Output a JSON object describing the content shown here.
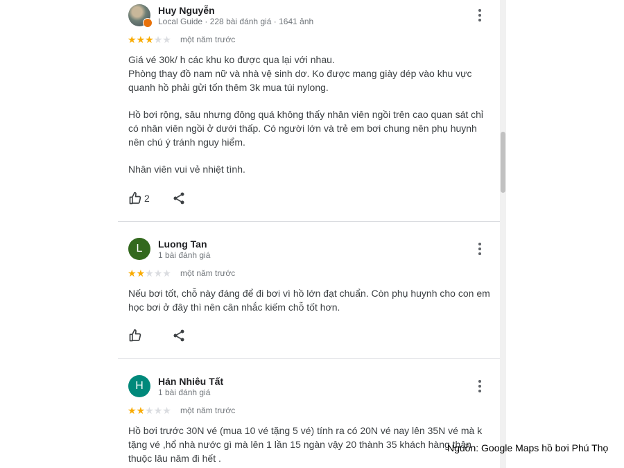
{
  "reviews": [
    {
      "avatar_letter": "",
      "name": "Huy Nguyễn",
      "meta": "Local Guide · 228 bài đánh giá · 1641 ảnh",
      "rating": 3,
      "time": "một năm trước",
      "paragraphs": [
        [
          "Giá vé 30k/ h các khu ko được qua lại với nhau.",
          "Phòng thay đồ nam nữ và nhà vệ sinh dơ. Ko được mang giày dép vào khu vực",
          "quanh hồ phải gửi tốn thêm 3k mua túi nylong."
        ],
        [
          "Hồ bơi rộng, sâu nhưng đông quá không thấy nhân viên ngồi trên cao quan sát chỉ",
          "có nhân viên ngồi ở dưới thấp. Có người lớn và trẻ em bơi chung nên phụ huynh",
          "nên chú ý tránh nguy hiểm."
        ],
        [
          "Nhân viên vui vẻ nhiệt tình."
        ]
      ],
      "likes": "2"
    },
    {
      "avatar_letter": "L",
      "avatar_color": "#33691e",
      "name": "Luong Tan",
      "meta": "1 bài đánh giá",
      "rating": 2,
      "time": "một năm trước",
      "paragraphs": [
        [
          "Nếu bơi tốt, chỗ này đáng để đi bơi vì hồ lớn đạt chuẩn. Còn phụ huynh cho con em",
          "học bơi ở đây thì nên cân nhắc kiếm chỗ tốt hơn."
        ]
      ],
      "likes": ""
    },
    {
      "avatar_letter": "H",
      "avatar_color": "#00897b",
      "name": "Hán Nhiêu Tất",
      "meta": "1 bài đánh giá",
      "rating": 2,
      "time": "một năm trước",
      "paragraphs": [
        [
          "Hồ bơi trước 30N vé (mua 10 vé tặng 5 vé) tính ra có 20N vé nay lên 35N vé mà k",
          "tặng vé ,hổ nhà nước gì mà lên 1 lần 15 ngàn vậy 20 thành 35 khách hàng thân",
          "thuộc lâu năm đi hết ."
        ]
      ]
    }
  ],
  "caption": "Nguồn: Google Maps hồ bơi Phú Thọ",
  "icons": {
    "more": "more-vert-icon",
    "like": "thumb-up-icon",
    "share": "share-icon"
  },
  "colors": {
    "star": "#f9ab00",
    "star_empty": "#dadce0",
    "meta": "#70757a"
  }
}
